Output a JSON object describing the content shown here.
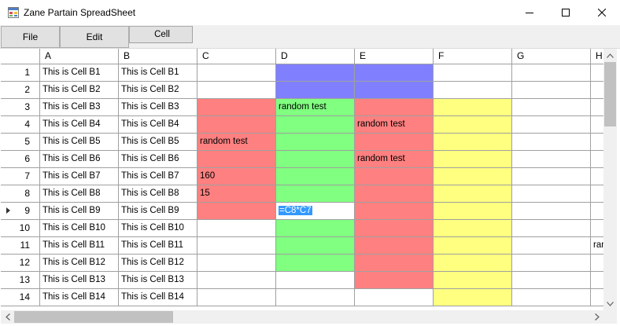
{
  "window": {
    "title": "Zane Partain SpreadSheet",
    "controls": {
      "minimize": "minimize-icon",
      "maximize": "maximize-icon",
      "close": "close-icon"
    }
  },
  "menu": {
    "file": "File",
    "edit": "Edit",
    "cell": "Cell"
  },
  "grid": {
    "columns": [
      "A",
      "B",
      "C",
      "D",
      "E",
      "F",
      "G",
      "H"
    ],
    "rows": [
      "1",
      "2",
      "3",
      "4",
      "5",
      "6",
      "7",
      "8",
      "9",
      "10",
      "11",
      "12",
      "13",
      "14"
    ],
    "current_row": "9",
    "colors": {
      "blue": "#8080ff",
      "red": "#ff8080",
      "green": "#80ff80",
      "yellow": "#ffff80",
      "selection": "#3399ff"
    },
    "cells": {
      "A1": "This is Cell B1",
      "B1": "This is Cell B1",
      "A2": "This is Cell B2",
      "B2": "This is Cell B2",
      "A3": "This is Cell B3",
      "B3": "This is Cell B3",
      "D3": "random test",
      "A4": "This is Cell B4",
      "B4": "This is Cell B4",
      "E4": "random test",
      "A5": "This is Cell B5",
      "B5": "This is Cell B5",
      "C5": "random test",
      "A6": "This is Cell B6",
      "B6": "This is Cell B6",
      "E6": "random test",
      "A7": "This is Cell B7",
      "B7": "This is Cell B7",
      "C7": "160",
      "A8": "This is Cell B8",
      "B8": "This is Cell B8",
      "C8": "15",
      "A9": "This is Cell B9",
      "B9": "This is Cell B9",
      "A10": "This is Cell B10",
      "B10": "This is Cell B10",
      "A11": "This is Cell B11",
      "B11": "This is Cell B11",
      "H11": "ran",
      "A12": "This is Cell B12",
      "B12": "This is Cell B12",
      "A13": "This is Cell B13",
      "B13": "This is Cell B13",
      "A14": "This is Cell B14",
      "B14": "This is Cell B14"
    },
    "editing": {
      "cell": "D9",
      "text": "=C8*C7"
    },
    "cell_colors": {
      "D1": "blue",
      "E1": "blue",
      "D2": "blue",
      "E2": "blue",
      "C3": "red",
      "C4": "red",
      "C5": "red",
      "C6": "red",
      "C7": "red",
      "C8": "red",
      "C9": "red",
      "D3": "green",
      "D4": "green",
      "D5": "green",
      "D6": "green",
      "D7": "green",
      "D8": "green",
      "D10": "green",
      "D11": "green",
      "D12": "green",
      "E3": "red",
      "E4": "red",
      "E5": "red",
      "E6": "red",
      "E7": "red",
      "E8": "red",
      "E9": "red",
      "E10": "red",
      "E11": "red",
      "E12": "red",
      "E13": "red",
      "F3": "yellow",
      "F4": "yellow",
      "F5": "yellow",
      "F6": "yellow",
      "F7": "yellow",
      "F8": "yellow",
      "F9": "yellow",
      "F10": "yellow",
      "F11": "yellow",
      "F12": "yellow",
      "F13": "yellow",
      "F14": "yellow"
    }
  },
  "scrollbars": {
    "vertical": "vertical-scrollbar",
    "horizontal": "horizontal-scrollbar"
  }
}
